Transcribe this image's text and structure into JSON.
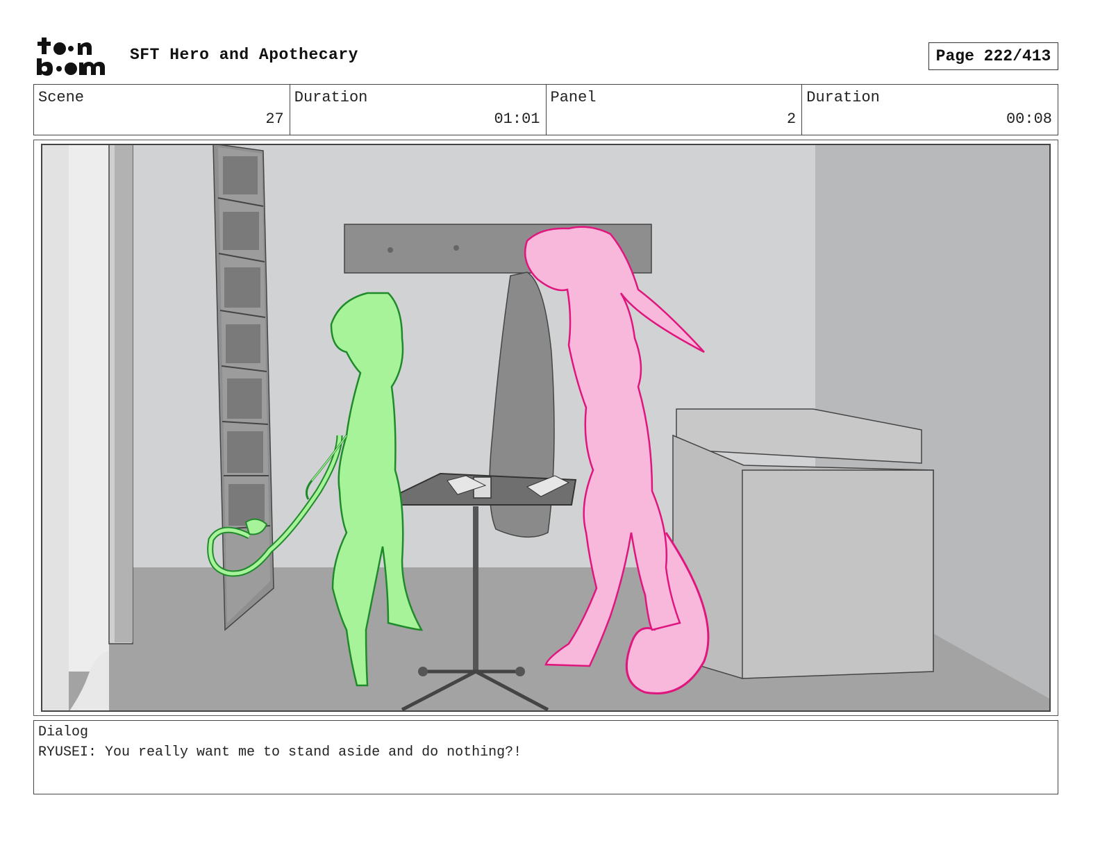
{
  "header": {
    "logo_text_top": "toon",
    "logo_text_bottom": "boom",
    "project_title": "SFT Hero and Apothecary",
    "page_label": "Page 222/413"
  },
  "info": {
    "scene_label": "Scene",
    "scene_value": "27",
    "scene_duration_label": "Duration",
    "scene_duration_value": "01:01",
    "panel_label": "Panel",
    "panel_value": "2",
    "panel_duration_label": "Duration",
    "panel_duration_value": "00:08"
  },
  "panel_image": {
    "description_icon": "storyboard-sketch",
    "colors": {
      "wall": "#d0d2d3",
      "floor": "#a3a3a3",
      "green_character": "#a6f39a",
      "green_outline": "#1f8a2a",
      "pink_character": "#f7b8dc",
      "pink_outline": "#e0157d"
    }
  },
  "dialog": {
    "label": "Dialog",
    "text": "RYUSEI: You really want me to stand aside and do nothing?!"
  }
}
